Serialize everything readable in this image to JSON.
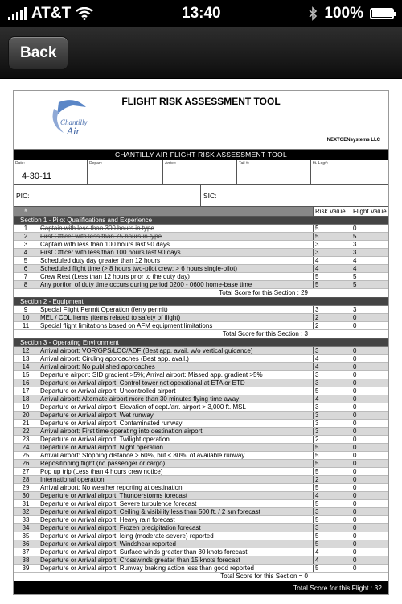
{
  "status": {
    "carrier": "AT&T",
    "time": "13:40",
    "battery": "100%",
    "battery_level": 1.0
  },
  "nav": {
    "back_label": "Back"
  },
  "doc": {
    "title": "FLIGHT RISK ASSESSMENT TOOL",
    "logo_text": "Chantilly Air",
    "vendor": "NEXTGENsystems LLC",
    "banner": "CHANTILLY AIR FLIGHT RISK ASSESSMENT TOOL",
    "fields": {
      "date_label": "Date:",
      "date_value": "4-30-11",
      "depart_label": "Depart:",
      "arrive_label": "Arrive:",
      "tail_label": "Tail #:",
      "log_label": "flt. Log#:",
      "pic_label": "PIC:",
      "sic_label": "SIC:"
    },
    "headers": {
      "num": "#",
      "risk": "Risk Value",
      "flight": "Flight Value"
    },
    "sections": [
      {
        "title": "Section 1 - Pilot Qualifications and Experience",
        "rows": [
          {
            "n": "1",
            "text": "Captain with less than 300 hours in type",
            "risk": "5",
            "flight": "0"
          },
          {
            "n": "2",
            "text": "First Officer with less than 75 hours in type",
            "risk": "5",
            "flight": "5"
          },
          {
            "n": "3",
            "text": "Captain with less than 100 hours last 90 days",
            "risk": "3",
            "flight": "3"
          },
          {
            "n": "4",
            "text": "First Officer with less than 100 hours last 90 days",
            "risk": "3",
            "flight": "3"
          },
          {
            "n": "5",
            "text": "Scheduled duty day greater than 12 hours",
            "risk": "4",
            "flight": "4"
          },
          {
            "n": "6",
            "text": "Scheduled flight time (> 8 hours two-pilot crew; > 6 hours single-pilot)",
            "risk": "4",
            "flight": "4"
          },
          {
            "n": "7",
            "text": "Crew Rest (Less than 12 hours prior to the duty day)",
            "risk": "5",
            "flight": "5"
          },
          {
            "n": "8",
            "text": "Any portion of duty time occurs during period 0200 - 0600 home-base time",
            "risk": "5",
            "flight": "5"
          }
        ],
        "total": "Total Score for this Section : 29"
      },
      {
        "title": "Section 2 - Equipment",
        "rows": [
          {
            "n": "9",
            "text": "Special Flight Permit Operation (ferry permit)",
            "risk": "3",
            "flight": "3"
          },
          {
            "n": "10",
            "text": "MEL / CDL Items (items related to safety of flight)",
            "risk": "2",
            "flight": "0"
          },
          {
            "n": "11",
            "text": "Special flight limitations based on AFM equipment limitations",
            "risk": "2",
            "flight": "0"
          }
        ],
        "total": "Total Score for this Section : 3"
      },
      {
        "title": "Section 3 - Operating Environment",
        "rows": [
          {
            "n": "12",
            "text": "Arrival airport: VOR/GPS/LOC/ADF (Best app. avail. w/o vertical guidance)",
            "risk": "3",
            "flight": "0"
          },
          {
            "n": "13",
            "text": "Arrival airport: Circling approaches (Best app. avail.)",
            "risk": "4",
            "flight": "0"
          },
          {
            "n": "14",
            "text": "Arrival airport: No published approaches",
            "risk": "4",
            "flight": "0"
          },
          {
            "n": "15",
            "text": "Departure airport: SID gradient >5%; Arrival airport: Missed app. gradient >5%",
            "risk": "3",
            "flight": "0"
          },
          {
            "n": "16",
            "text": "Departure or Arrival airport: Control tower not operational at ETA or ETD",
            "risk": "3",
            "flight": "0"
          },
          {
            "n": "17",
            "text": "Departure or Arrival airport: Uncontrolled airport",
            "risk": "5",
            "flight": "0"
          },
          {
            "n": "18",
            "text": "Arrival airport: Alternate airport more than 30 minutes flying time away",
            "risk": "4",
            "flight": "0"
          },
          {
            "n": "19",
            "text": "Departure or Arrival airport: Elevation of dept./arr. airport > 3,000 ft. MSL",
            "risk": "3",
            "flight": "0"
          },
          {
            "n": "20",
            "text": "Departure or Arrival airport: Wet runway",
            "risk": "3",
            "flight": "0"
          },
          {
            "n": "21",
            "text": "Departure or Arrival airport: Contaminated runway",
            "risk": "3",
            "flight": "0"
          },
          {
            "n": "22",
            "text": "Arrival airport: First time operating into destination airport",
            "risk": "3",
            "flight": "0"
          },
          {
            "n": "23",
            "text": "Departure or Arrival airport: Twilight operation",
            "risk": "2",
            "flight": "0"
          },
          {
            "n": "24",
            "text": "Departure or Arrival airport: Night operation",
            "risk": "5",
            "flight": "0"
          },
          {
            "n": "25",
            "text": "Arrival airport: Stopping distance > 60%, but < 80%, of available runway",
            "risk": "5",
            "flight": "0"
          },
          {
            "n": "26",
            "text": "Repositioning flight (no passenger or cargo)",
            "risk": "5",
            "flight": "0"
          },
          {
            "n": "27",
            "text": "Pop up trip (Less than 4 hours crew notice)",
            "risk": "5",
            "flight": "0"
          },
          {
            "n": "28",
            "text": "International operation",
            "risk": "2",
            "flight": "0"
          },
          {
            "n": "29",
            "text": "Arrival airport: No weather reporting at destination",
            "risk": "5",
            "flight": "0"
          },
          {
            "n": "30",
            "text": "Departure or Arrival airport: Thunderstorms forecast",
            "risk": "4",
            "flight": "0"
          },
          {
            "n": "31",
            "text": "Departure or Arrival airport: Severe turbulence forecast",
            "risk": "5",
            "flight": "0"
          },
          {
            "n": "32",
            "text": "Departure or Arrival airport: Ceiling & visibility less than 500 ft. / 2 sm forecast",
            "risk": "3",
            "flight": "0"
          },
          {
            "n": "33",
            "text": "Departure or Arrival airport: Heavy rain forecast",
            "risk": "5",
            "flight": "0"
          },
          {
            "n": "34",
            "text": "Departure or Arrival airport: Frozen precipitation forecast",
            "risk": "3",
            "flight": "0"
          },
          {
            "n": "35",
            "text": "Departure or Arrival airport: Icing (moderate-severe) reported",
            "risk": "5",
            "flight": "0"
          },
          {
            "n": "36",
            "text": "Departure or Arrival airport: Windshear reported",
            "risk": "5",
            "flight": "0"
          },
          {
            "n": "37",
            "text": "Departure or Arrival airport: Surface winds greater than 30 knots forecast",
            "risk": "4",
            "flight": "0"
          },
          {
            "n": "38",
            "text": "Departure or Arrival airport: Crosswinds greater than 15 knots forecast",
            "risk": "4",
            "flight": "0"
          },
          {
            "n": "39",
            "text": "Departure or Arrival airport: Runway braking action less than good reported",
            "risk": "5",
            "flight": "0"
          }
        ],
        "total": "Total Score for this Section = 0"
      }
    ],
    "grand_total": "Total Score for this Flight : 32"
  }
}
